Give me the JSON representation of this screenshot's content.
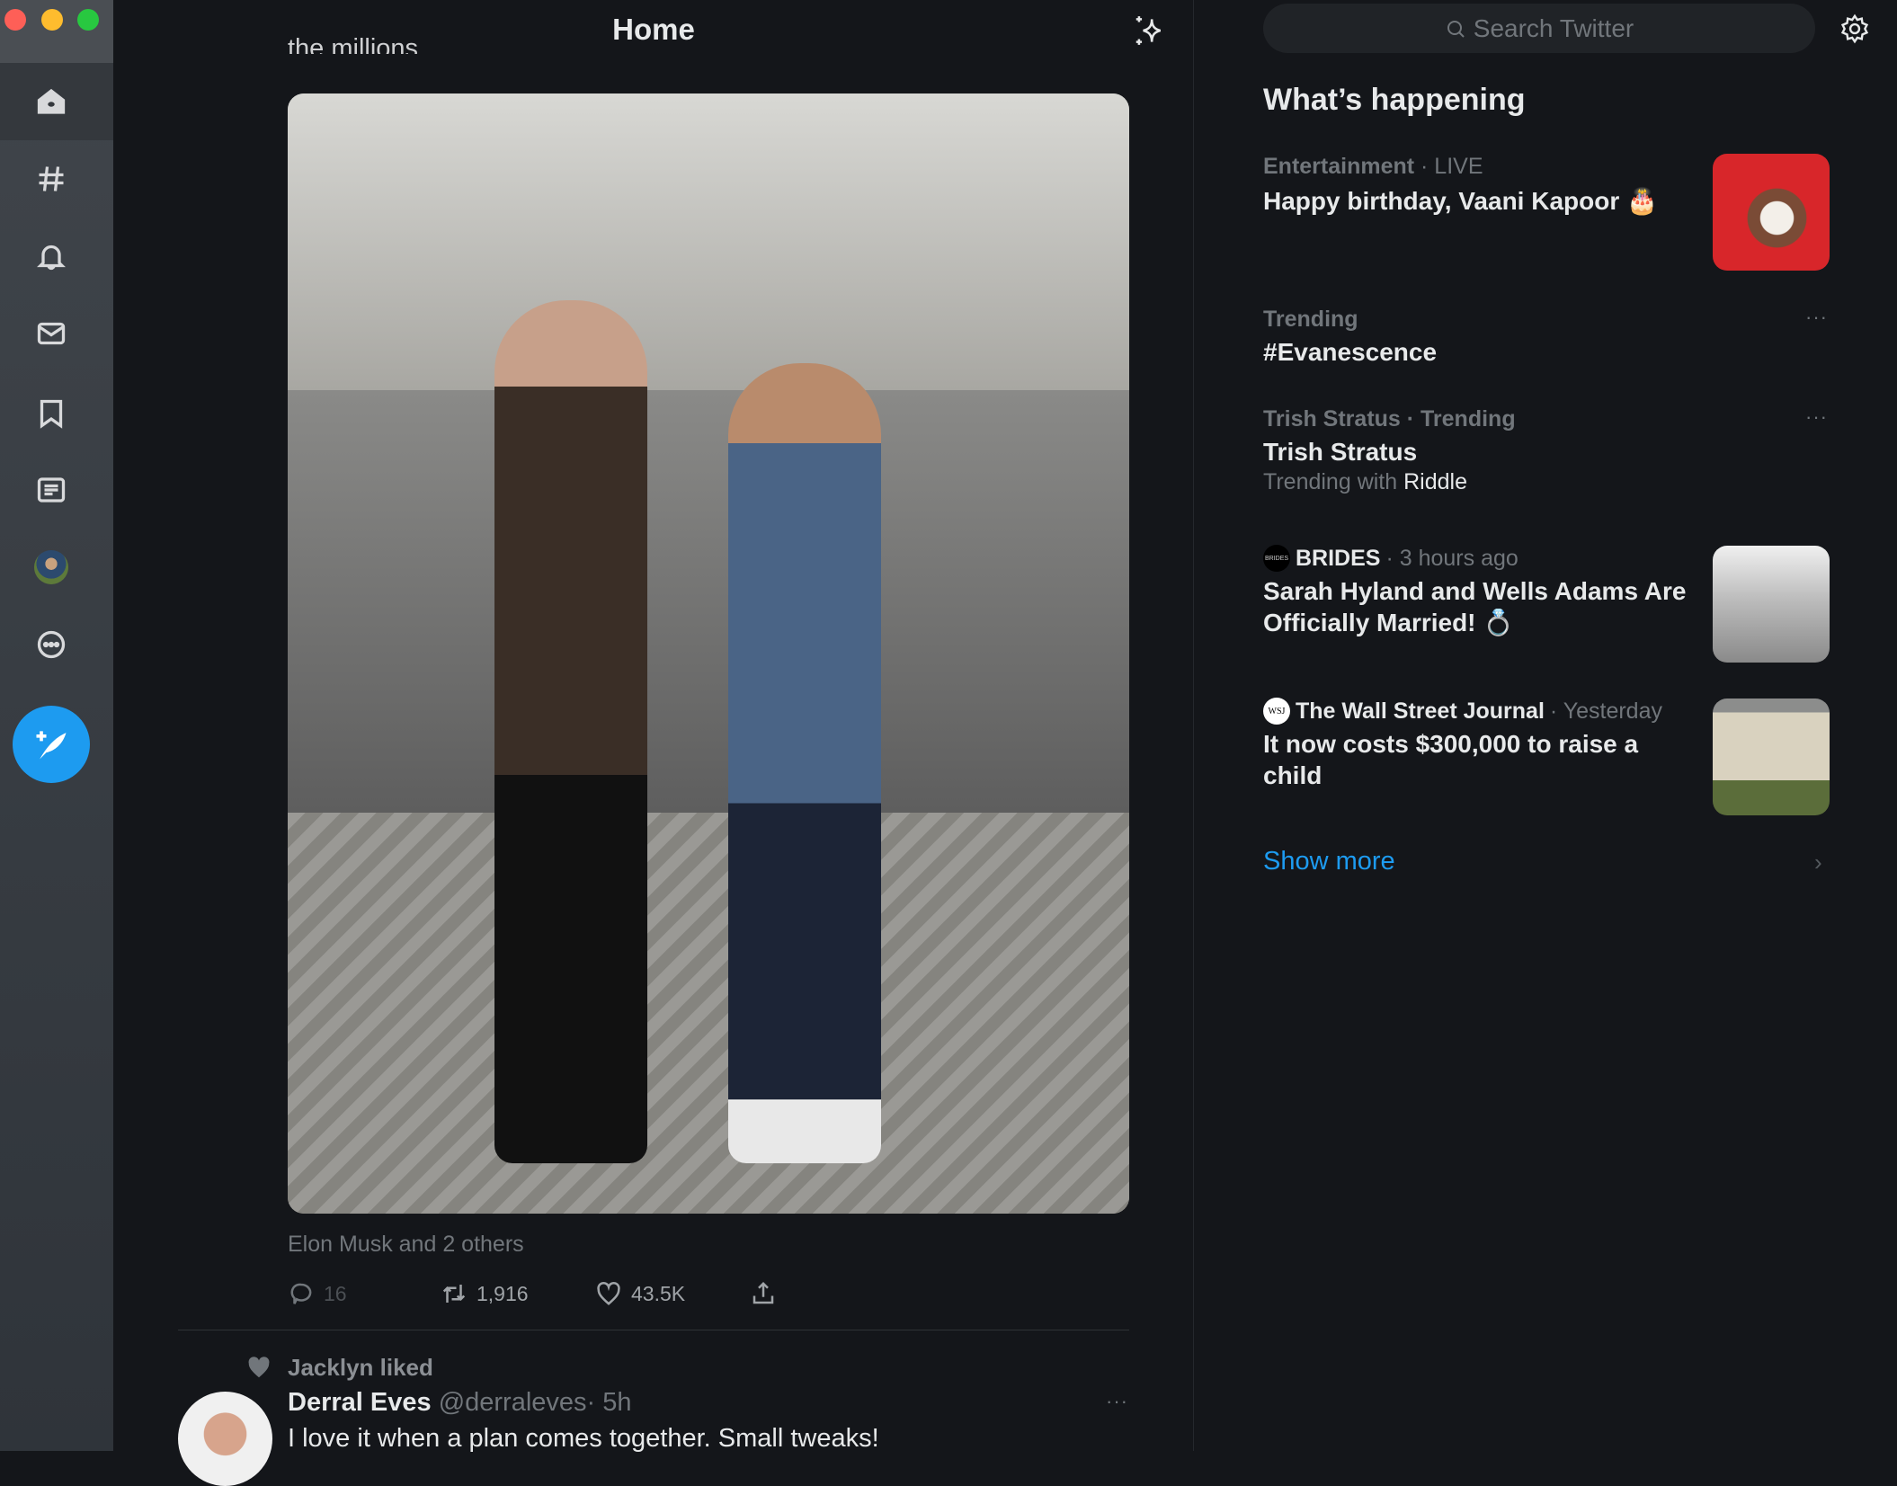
{
  "window": {
    "controls": [
      "close",
      "minimize",
      "zoom"
    ]
  },
  "sidebar": {
    "items": [
      {
        "name": "home",
        "icon": "home-icon",
        "active": true
      },
      {
        "name": "explore",
        "icon": "hashtag-icon"
      },
      {
        "name": "notifications",
        "icon": "bell-icon"
      },
      {
        "name": "messages",
        "icon": "mail-icon"
      },
      {
        "name": "bookmarks",
        "icon": "bookmark-icon"
      },
      {
        "name": "lists",
        "icon": "list-icon"
      },
      {
        "name": "profile",
        "icon": "avatar"
      },
      {
        "name": "more",
        "icon": "more-circle-icon"
      }
    ],
    "compose_icon": "compose-feather-icon"
  },
  "header": {
    "title": "Home",
    "sparkle_icon": "sparkle-icon"
  },
  "feed": {
    "partial_text": "the millions",
    "tweet": {
      "tagged": "Elon Musk and 2 others",
      "replies": "16",
      "retweets": "1,916",
      "likes": "43.5K"
    },
    "next": {
      "social_context": "Jacklyn liked",
      "name": "Derral Eves",
      "handle": "@derraleves",
      "time": "· 5h",
      "text": "I love it when a plan comes together. Small tweaks!"
    }
  },
  "search": {
    "placeholder": "Search Twitter"
  },
  "trends": {
    "title": "What’s happening",
    "items": [
      {
        "category": "Entertainment",
        "suffix": " · LIVE",
        "headline": "Happy birthday, Vaani Kapoor 🎂"
      },
      {
        "category": "Trending",
        "headline": "#Evanescence"
      },
      {
        "category": "Trish Stratus · Trending",
        "headline": "Trish Stratus",
        "with_label": "Trending with ",
        "with_value": "Riddle"
      },
      {
        "source": "BRIDES",
        "logo": "BRIDES",
        "time": " · 3 hours ago",
        "headline": "Sarah Hyland and Wells Adams Are Officially Married! 💍"
      },
      {
        "source": "The Wall Street Journal",
        "logo": "WSJ",
        "time": " · Yesterday",
        "headline": "It now costs $300,000 to raise a child"
      }
    ],
    "show_more": "Show more"
  },
  "colors": {
    "accent": "#1d9bf0",
    "background": "#14161a",
    "muted": "#71767b"
  }
}
